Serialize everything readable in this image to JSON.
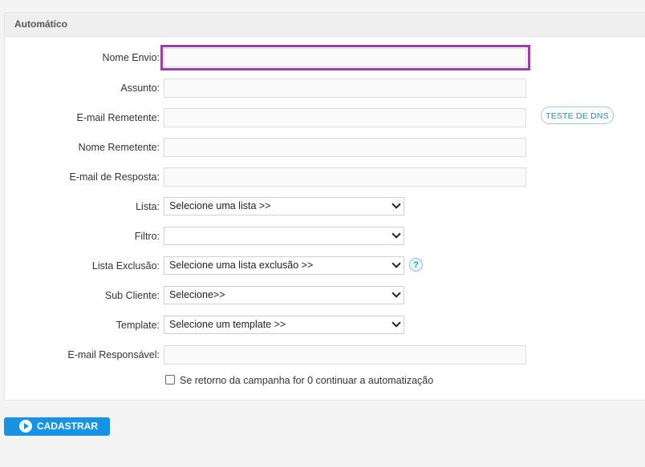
{
  "panel": {
    "title": "Automático"
  },
  "form": {
    "nome_envio": {
      "label": "Nome Envio:",
      "value": ""
    },
    "assunto": {
      "label": "Assunto:",
      "value": ""
    },
    "email_remetente": {
      "label": "E-mail Remetente:",
      "value": ""
    },
    "dns_button": "TESTE DE DNS",
    "nome_remetente": {
      "label": "Nome Remetente:",
      "value": ""
    },
    "email_resposta": {
      "label": "E-mail de Resposta:",
      "value": ""
    },
    "lista": {
      "label": "Lista:",
      "selected": "Selecione uma lista >>"
    },
    "filtro": {
      "label": "Filtro:",
      "selected": ""
    },
    "lista_exclusao": {
      "label": "Lista Exclusão:",
      "selected": "Selecione uma lista exclusão >>"
    },
    "help_icon": "?",
    "sub_cliente": {
      "label": "Sub Cliente:",
      "selected": "Selecione>>"
    },
    "template": {
      "label": "Template:",
      "selected": "Selecione um template >>"
    },
    "email_responsavel": {
      "label": "E-mail Responsável:",
      "value": ""
    },
    "checkbox_label": "Se retorno da campanha for 0 continuar a automatização",
    "checkbox_checked": false
  },
  "submit": {
    "label": "CADASTRAR"
  },
  "colors": {
    "highlight": "#9b3fa6",
    "primary": "#1793e6",
    "link": "#2a8ac4"
  }
}
